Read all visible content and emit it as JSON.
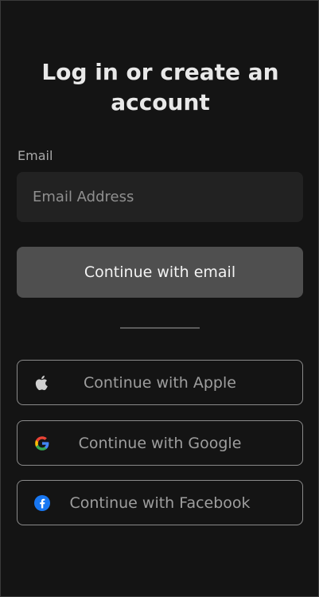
{
  "header": {
    "title": "Log in or create an account"
  },
  "email": {
    "label": "Email",
    "placeholder": "Email Address",
    "value": ""
  },
  "buttons": {
    "continue_email": "Continue with email",
    "apple": "Continue with Apple",
    "google": "Continue with Google",
    "facebook": "Continue with Facebook"
  },
  "icons": {
    "apple": "apple-icon",
    "google": "google-icon",
    "facebook": "facebook-icon"
  },
  "colors": {
    "background": "#141414",
    "input_background": "#222222",
    "primary_button": "#4f4f4f",
    "border": "#8a8a8a",
    "google_blue": "#4285F4",
    "google_red": "#EA4335",
    "google_yellow": "#FBBC05",
    "google_green": "#34A853",
    "facebook_blue": "#1877F2"
  }
}
